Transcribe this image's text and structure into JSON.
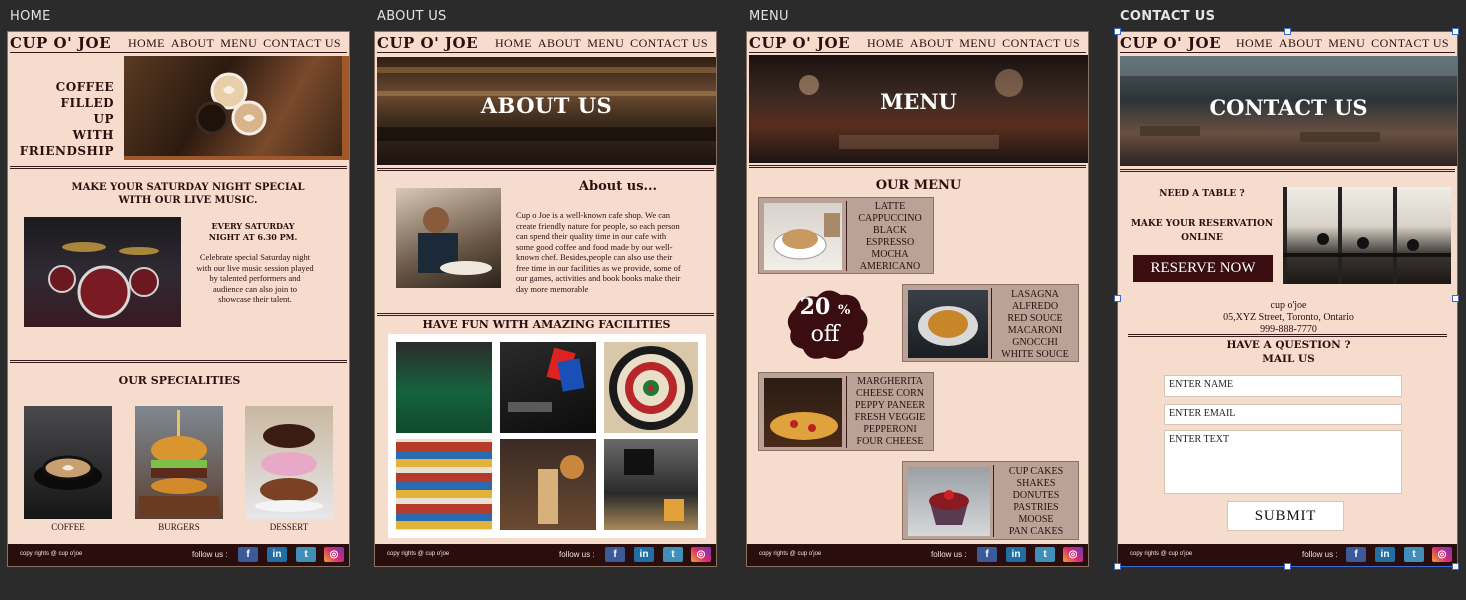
{
  "frames": {
    "home": "HOME",
    "about": "ABOUT US",
    "menu": "MENU",
    "contact": "CONTACT US"
  },
  "site": {
    "brand": "CUP O' JOE",
    "nav": [
      "HOME",
      "ABOUT",
      "MENU",
      "CONTACT US"
    ],
    "footer_copyright": "copy rights @ cup o'joe",
    "footer_follow": "follow us :",
    "social": [
      "facebook-icon",
      "linkedin-icon",
      "twitter-icon",
      "instagram-icon"
    ]
  },
  "home": {
    "hero_lines": [
      "COFFEE",
      "FILLED",
      "UP",
      "WITH",
      "FRIENDSHIP"
    ],
    "event_title": "MAKE YOUR SATURDAY NIGHT SPECIAL WITH OUR LIVE MUSIC.",
    "event_when": "EVERY SATURDAY NIGHT AT 6.30 PM.",
    "event_desc": "Celebrate special Saturday night with our live music session played by talented performers and audience can also join to showcase their talent.",
    "specialities_title": "OUR SPECIALITIES",
    "specialities": [
      "COFFEE",
      "BURGERS",
      "DESSERT"
    ]
  },
  "about": {
    "banner": "ABOUT US",
    "heading": "About us...",
    "body": "Cup o Joe is a well-known cafe shop. We can create friendly nature for people, so each person can spend their quality time in our cafe with some good coffee and food made by our well-known chef. Besides,people can also use their free time in our facilities as we provide, some of our games, activities and book books make their day more memorable",
    "facilities_title": "HAVE FUN WITH AMAZING FACILITIES"
  },
  "menu": {
    "banner": "MENU",
    "title": "OUR MENU",
    "offer_value": "20",
    "offer_unit": "%",
    "offer_word": "off",
    "coffee": [
      "LATTE",
      "CAPPUCCINO",
      "BLACK",
      "ESPRESSO",
      "MOCHA",
      "AMERICANO"
    ],
    "pasta": [
      "LASAGNA",
      "ALFREDO",
      "RED SOUCE",
      "MACARONI",
      "GNOCCHI",
      "WHITE SOUCE"
    ],
    "pizza": [
      "MARGHERITA",
      "CHEESE CORN",
      "PEPPY PANEER",
      "FRESH VEGGIE",
      "PEPPERONI",
      "FOUR CHEESE"
    ],
    "desserts": [
      "CUP CAKES",
      "SHAKES",
      "DONUTES",
      "PASTRIES",
      "MOOSE",
      "PAN CAKES"
    ]
  },
  "contact": {
    "banner": "CONTACT US",
    "need_table": "NEED A TABLE ?",
    "reservation": "MAKE YOUR RESERVATION ONLINE",
    "reserve_button": "RESERVE NOW",
    "addr_name": "cup o'joe",
    "addr_street": "05,XYZ Street, Toronto, Ontario",
    "addr_phone": "999-888-7770",
    "question": "HAVE A QUESTION ?",
    "mail_us": "MAIL US",
    "name_placeholder": "ENTER NAME",
    "email_placeholder": "ENTER EMAIL",
    "text_placeholder": "ENTER TEXT",
    "submit": "SUBMIT"
  }
}
